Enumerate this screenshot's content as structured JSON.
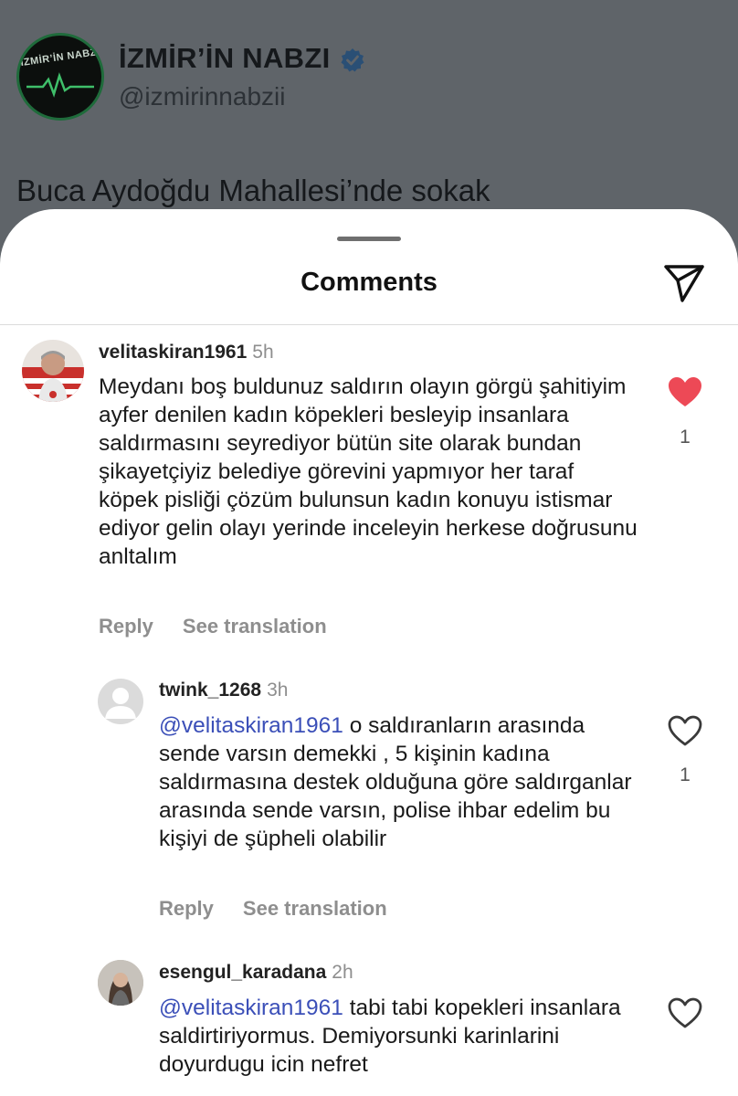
{
  "post": {
    "account_name": "İZMİR’İN NABZI",
    "handle": "@izmirinnabzii",
    "text_preview": "Buca Aydoğdu Mahallesi’nde sokak",
    "avatar_logo_text": "İZMİR’İN NABZI"
  },
  "sheet": {
    "title": "Comments",
    "share_icon": "send-icon"
  },
  "comments": [
    {
      "username": "velitaskiran1961",
      "time": "5h",
      "text": "Meydanı boş buldunuz saldırın olayın görgü şahitiyim ayfer denilen kadın köpekleri besleyip insanlara saldırmasını seyrediyor bütün site olarak bundan şikayetçiyiz belediye görevini yapmıyor her taraf köpek pisliği çözüm bulunsun kadın konuyu istismar ediyor gelin olayı yerinde inceleyin herkese doğrusunu anltalım",
      "like_count": "1",
      "liked": true,
      "reply_label": "Reply",
      "translate_label": "See translation"
    },
    {
      "username": "twink_1268",
      "time": "3h",
      "mention": "@velitaskiran1961",
      "text": " o saldıranların arasında sende varsın demekki , 5 kişinin kadına saldırmasına destek olduğuna göre saldırganlar arasında sende varsın, polise ihbar edelim bu kişiyi de şüpheli olabilir",
      "like_count": "1",
      "liked": false,
      "reply_label": "Reply",
      "translate_label": "See translation"
    },
    {
      "username": "esengul_karadana",
      "time": "2h",
      "mention": "@velitaskiran1961",
      "text": " tabi tabi kopekleri insanlara saldirtiriyormus. Demiyorsunki karinlarini doyurdugu icin nefret",
      "liked": false
    }
  ],
  "colors": {
    "like_red": "#ed4956",
    "mention_blue": "#3b4fb8",
    "verified_blue": "#1d9bf0"
  }
}
